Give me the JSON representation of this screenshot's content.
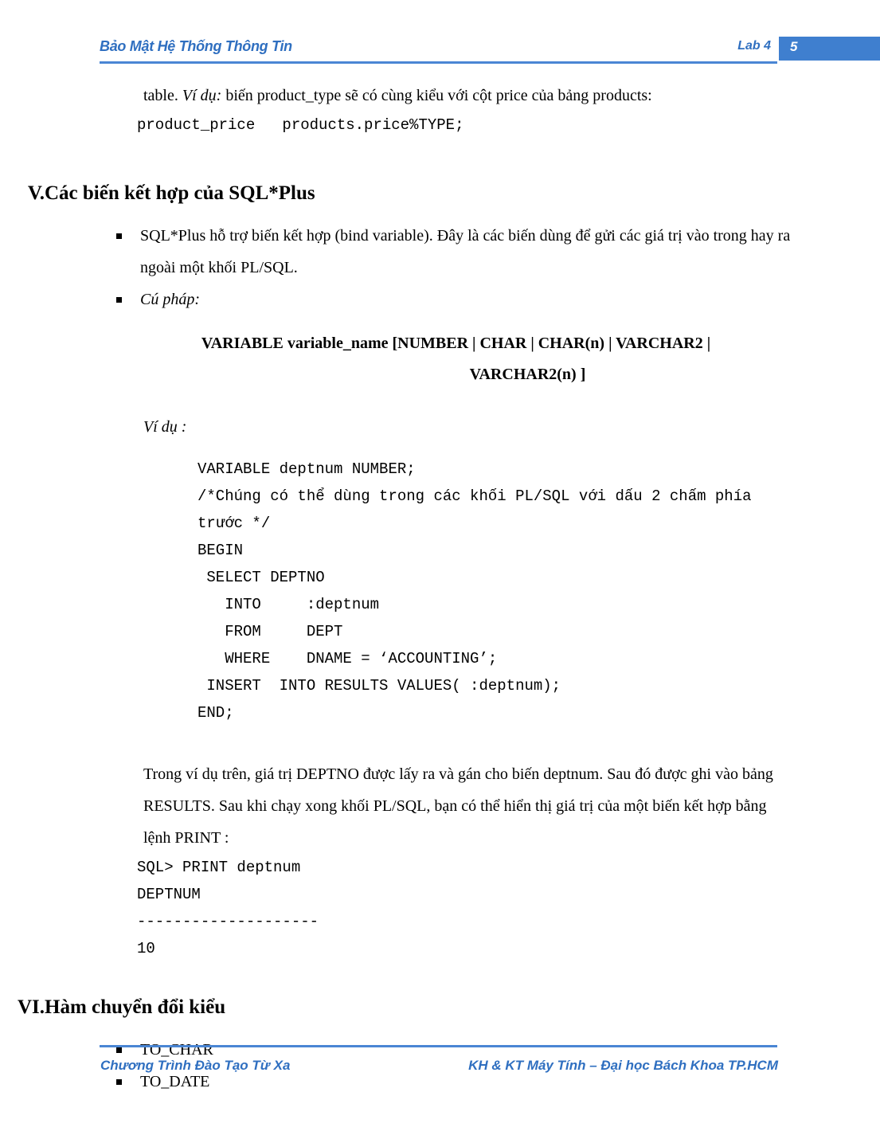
{
  "header": {
    "title": "Bảo Mật Hệ Thống Thông Tin",
    "lab": "Lab 4",
    "page_number": "5",
    "accent_color": "#3f7fcf",
    "rule_color": "#4a86d4",
    "text_color": "#2f6fc0"
  },
  "body": {
    "intro": {
      "lead": "table. ",
      "vidu_italic": "Ví dụ:",
      "rest": " biến product_type sẽ có cùng kiểu với cột price của bảng products:",
      "code": "product_price   products.price%TYPE;"
    },
    "section_v": {
      "number": "V.",
      "title": "Các biến kết hợp của SQL*Plus",
      "bullets": [
        "SQL*Plus hỗ trợ biến kết hợp (bind variable). Đây là các biến dùng để gửi các giá trị vào trong hay ra ngoài một khối PL/SQL.",
        "Cú pháp:"
      ],
      "syntax_line1": "VARIABLE  variable_name [NUMBER | CHAR | CHAR(n) | VARCHAR2 |",
      "syntax_line2": "VARCHAR2(n)  ]",
      "example_label": "Ví dụ :",
      "code_lines": [
        "VARIABLE deptnum NUMBER;",
        "/*Chúng có thể dùng trong các khối PL/SQL với dấu 2 chấm phía",
        "trước */",
        "BEGIN",
        " SELECT DEPTNO",
        "   INTO     :deptnum",
        "   FROM     DEPT",
        "   WHERE    DNAME = ‘ACCOUNTING’;",
        " INSERT  INTO RESULTS VALUES( :deptnum);",
        "END;"
      ],
      "closing_paragraph": "Trong ví dụ trên, giá trị DEPTNO được lấy ra và gán cho biến deptnum. Sau đó được ghi vào bảng RESULTS. Sau khi chạy xong khối PL/SQL, bạn có thể hiển thị giá trị của một biến kết hợp bằng lệnh PRINT :",
      "print_output": [
        "SQL> PRINT deptnum",
        "DEPTNUM",
        "--------------------",
        "10"
      ]
    },
    "section_vi": {
      "number": "VI.",
      "title": "Hàm chuyển đổi kiểu",
      "bullets": [
        "TO_CHAR",
        "TO_DATE"
      ]
    }
  },
  "footer": {
    "left": "Chương Trình Đào Tạo Từ Xa",
    "right": "KH & KT Máy Tính – Đại học Bách Khoa TP.HCM"
  }
}
